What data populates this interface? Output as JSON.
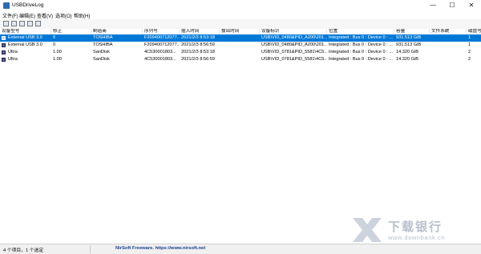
{
  "window": {
    "title": "USBDriveLog",
    "min": "—",
    "max": "☐",
    "close": "✕"
  },
  "menu": [
    "文件(F)",
    "编辑(E)",
    "查看(V)",
    "选项(O)",
    "帮助(H)"
  ],
  "toolbar": {
    "icons": [
      "save-icon",
      "copy-icon",
      "properties-icon",
      "refresh-icon",
      "export-icon"
    ]
  },
  "columns": [
    "设备型号",
    "修正",
    "制造商",
    "序列号",
    "插入时间",
    "拔出时间",
    "设备标识",
    "位置",
    "容量",
    "文件系统",
    "磁盘号"
  ],
  "rows": [
    [
      "External USB 3.0",
      "0",
      "TOSHIBA",
      "F209400712077...",
      "2021/2/3 8:53:18",
      "",
      "USB\\VID_0480&PID_A200\\201...",
      "Integrated : Bus 0 : Device 0 : ...",
      "931.513 GiB",
      "",
      "1"
    ],
    [
      "External USB 3.0",
      "0",
      "TOSHIBA",
      "F209400712077...",
      "2021/2/3 8:56:59",
      "",
      "USB\\VID_0480&PID_A200\\201...",
      "Integrated : Bus 0 : Device 0 : ...",
      "931.513 GiB",
      "",
      "1"
    ],
    [
      "Ultra",
      "1.00",
      "SanDisk",
      "4C530001803...",
      "2021/2/3 8:53:18",
      "",
      "USB\\VID_0781&PID_5581\\4C5...",
      "Integrated : Bus 0 : Device 0 : ...",
      "14.320 GiB",
      "",
      "2"
    ],
    [
      "Ultra",
      "1.00",
      "SanDisk",
      "4C530001803...",
      "2021/2/3 8:56:59",
      "",
      "USB\\VID_0781&PID_5581\\4C5...",
      "Integrated : Bus 0 : Device 0 : ...",
      "14.320 GiB",
      "",
      "2"
    ]
  ],
  "selected_row": 0,
  "status": {
    "left": "4 个项目，1 个选定",
    "center": "NirSoft Freeware. https://www.nirsoft.net"
  },
  "watermark": {
    "text": "下载银行",
    "sub": "www.downbank.cn"
  },
  "colors": {
    "selection": "#0078d7",
    "link": "#1b3d8f"
  }
}
